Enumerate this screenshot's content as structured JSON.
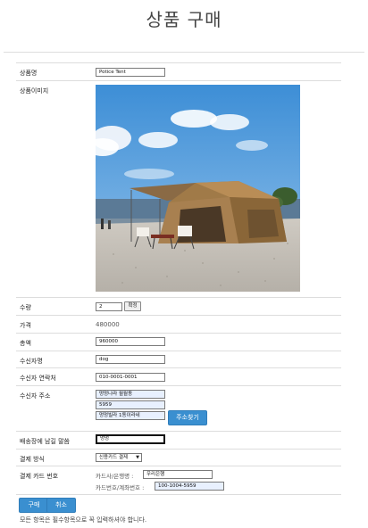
{
  "page": {
    "title": "상품 구매"
  },
  "fields": {
    "product_name": {
      "label": "상품명",
      "value": "Potice Tent"
    },
    "product_image": {
      "label": "상품이미지"
    },
    "quantity": {
      "label": "수량",
      "value": "2",
      "confirm_label": "확정"
    },
    "price": {
      "label": "가격",
      "value": "480000"
    },
    "total": {
      "label": "총액",
      "value": "960000"
    },
    "recipient": {
      "label": "수신자명",
      "value": "dog"
    },
    "contact": {
      "label": "수신자 연락처",
      "value": "010-0001-0001"
    },
    "address": {
      "label": "수신자 주소",
      "line1": "멍멍나라 월월동",
      "line2": "5959",
      "line3": "멍멍빌라 1동이라네",
      "find_label": "주소찾기"
    },
    "message": {
      "label": "배송장에 남길 말씀",
      "value": "멍멍"
    },
    "payment_method": {
      "label": "결제 방식",
      "selected": "신용카드 결제"
    },
    "card": {
      "label": "결제 카드 번호",
      "company_label": "카드사/은행명 :",
      "company_value": "우리은행",
      "number_label": "카드번호/계좌번호 :",
      "number_value": "100-1004-5959"
    }
  },
  "actions": {
    "purchase_label": "구매",
    "cancel_label": "취소"
  },
  "footer_note": "모든 항목은 필수항목으로 꼭 입력하셔야 합니다."
}
